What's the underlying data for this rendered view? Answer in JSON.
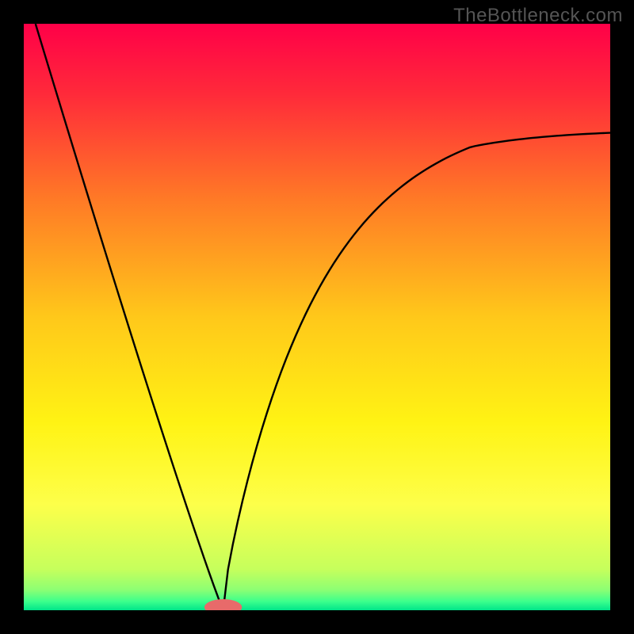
{
  "watermark": "TheBottleneck.com",
  "chart_data": {
    "type": "line",
    "title": "",
    "xlabel": "",
    "ylabel": "",
    "xlim": [
      0,
      100
    ],
    "ylim": [
      0,
      100
    ],
    "background_gradient": {
      "stops": [
        {
          "offset": 0.0,
          "color": "#ff0048"
        },
        {
          "offset": 0.12,
          "color": "#ff2a3a"
        },
        {
          "offset": 0.3,
          "color": "#ff7a26"
        },
        {
          "offset": 0.5,
          "color": "#ffc81a"
        },
        {
          "offset": 0.68,
          "color": "#fff314"
        },
        {
          "offset": 0.82,
          "color": "#fdff4a"
        },
        {
          "offset": 0.93,
          "color": "#c6ff5c"
        },
        {
          "offset": 0.965,
          "color": "#8dff73"
        },
        {
          "offset": 0.985,
          "color": "#3cff8c"
        },
        {
          "offset": 1.0,
          "color": "#00e58a"
        }
      ]
    },
    "series": [
      {
        "name": "bottleneck-curve",
        "x_min_at": 34,
        "y_min": 0,
        "left_start": {
          "x": 2,
          "y": 100
        },
        "right_end": {
          "x": 100,
          "y": 82
        },
        "color": "#000000"
      }
    ],
    "markers": [
      {
        "name": "min-marker",
        "x": 34,
        "y": 0.5,
        "color": "#e86a6a",
        "rx": 3.2,
        "ry": 1.4
      }
    ]
  }
}
